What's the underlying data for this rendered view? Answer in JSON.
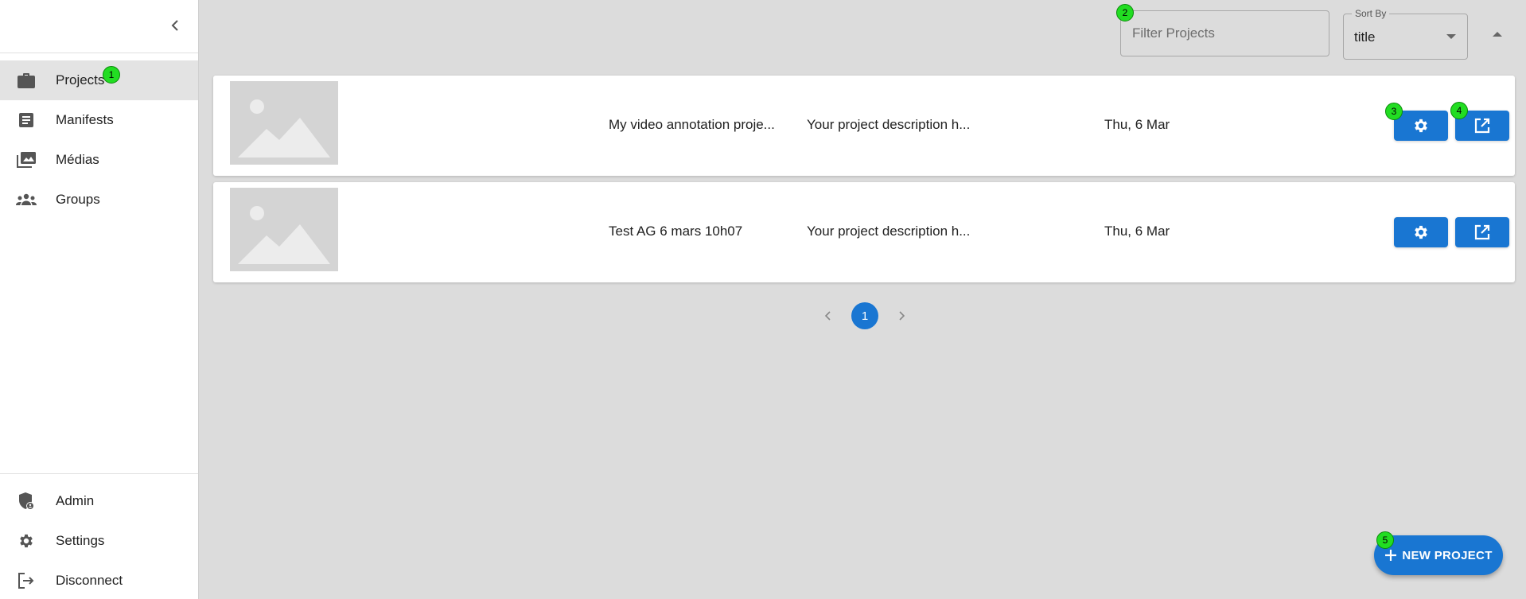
{
  "sidebar": {
    "collapse_icon": "chevron-left-icon",
    "items": [
      {
        "label": "Projects",
        "icon": "briefcase-icon"
      },
      {
        "label": "Manifests",
        "icon": "document-icon"
      },
      {
        "label": "Médias",
        "icon": "photo-library-icon"
      },
      {
        "label": "Groups",
        "icon": "groups-icon"
      }
    ],
    "bottom_items": [
      {
        "label": "Admin",
        "icon": "admin-shield-icon"
      },
      {
        "label": "Settings",
        "icon": "gear-icon"
      },
      {
        "label": "Disconnect",
        "icon": "logout-icon"
      }
    ]
  },
  "header": {
    "filter": {
      "placeholder": "Filter Projects",
      "value": ""
    },
    "sort": {
      "label": "Sort By",
      "value": "title",
      "direction": "ascending"
    }
  },
  "projects": [
    {
      "title": "My video annotation proje...",
      "description": "Your project description h...",
      "date": "Thu, 6 Mar"
    },
    {
      "title": "Test AG 6 mars 10h07",
      "description": "Your project description h...",
      "date": "Thu, 6 Mar"
    }
  ],
  "pagination": {
    "current_page": "1"
  },
  "fab": {
    "label": "NEW PROJECT"
  },
  "badges": [
    "1",
    "2",
    "3",
    "4",
    "5"
  ],
  "colors": {
    "primary": "#1976d2",
    "background": "#dcdcdc",
    "badge": "#22dd22"
  }
}
